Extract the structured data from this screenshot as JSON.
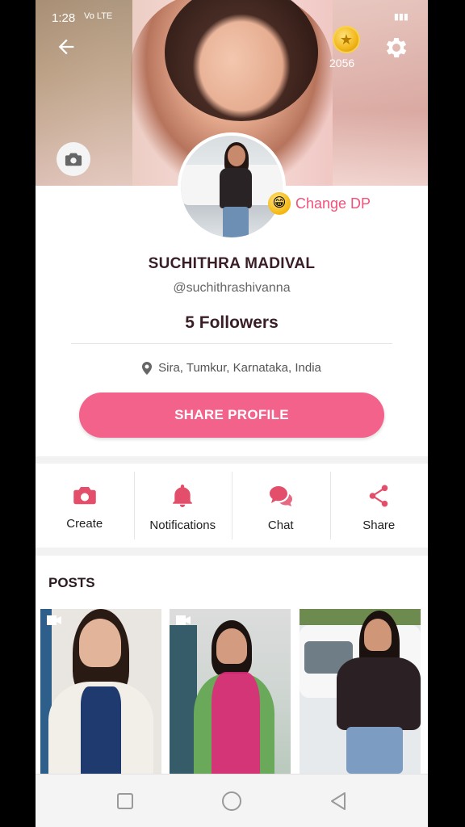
{
  "status": {
    "time": "1:28",
    "network": "Vo LTE"
  },
  "header": {
    "coin_count": "2056"
  },
  "profile": {
    "change_dp_label": "Change DP",
    "name": "SUCHITHRA MADIVAL",
    "handle": "@suchithrashivanna",
    "followers": "5 Followers",
    "location": "Sira, Tumkur, Karnataka, India",
    "share_label": "SHARE PROFILE"
  },
  "actions": [
    {
      "label": "Create",
      "icon": "camera-icon"
    },
    {
      "label": "Notifications",
      "icon": "bell-icon"
    },
    {
      "label": "Chat",
      "icon": "chat-icon"
    },
    {
      "label": "Share",
      "icon": "share-icon"
    }
  ],
  "posts": {
    "title": "POSTS"
  },
  "colors": {
    "accent": "#f3628a",
    "icon_red": "#e34f6b",
    "text_dark": "#3a1e26"
  }
}
